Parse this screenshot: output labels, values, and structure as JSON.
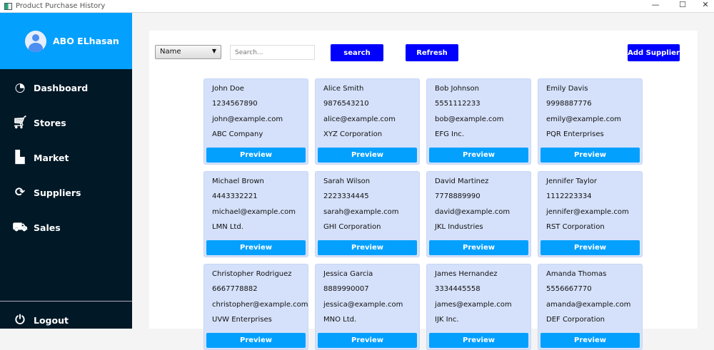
{
  "window": {
    "title": "Product Purchase History",
    "minimize": "—",
    "maximize": "☐",
    "close": "✕"
  },
  "sidebar": {
    "user": "ABO ELhasan",
    "items": [
      {
        "label": "Dashboard",
        "icon": "dashboard-icon"
      },
      {
        "label": "Stores",
        "icon": "cart-icon"
      },
      {
        "label": "Market",
        "icon": "store-icon"
      },
      {
        "label": "Suppliers",
        "icon": "suppliers-icon"
      },
      {
        "label": "Sales",
        "icon": "sales-icon"
      }
    ],
    "logout": "Logout"
  },
  "toolbar": {
    "filter": "Name",
    "search_placeholder": "Search...",
    "search_label": "search",
    "refresh_label": "Refresh",
    "add_label": "Add Supplier"
  },
  "suppliers": [
    {
      "name": "John Doe",
      "phone": "1234567890",
      "email": "john@example.com",
      "company": "ABC Company"
    },
    {
      "name": "Alice Smith",
      "phone": "9876543210",
      "email": "alice@example.com",
      "company": "XYZ Corporation"
    },
    {
      "name": "Bob Johnson",
      "phone": "5551112233",
      "email": "bob@example.com",
      "company": "EFG Inc."
    },
    {
      "name": "Emily Davis",
      "phone": "9998887776",
      "email": "emily@example.com",
      "company": "PQR Enterprises"
    },
    {
      "name": "Michael Brown",
      "phone": "4443332221",
      "email": "michael@example.com",
      "company": "LMN Ltd."
    },
    {
      "name": "Sarah Wilson",
      "phone": "2223334445",
      "email": "sarah@example.com",
      "company": "GHI Corporation"
    },
    {
      "name": "David Martinez",
      "phone": "7778889990",
      "email": "david@example.com",
      "company": "JKL Industries"
    },
    {
      "name": "Jennifer Taylor",
      "phone": "1112223334",
      "email": "jennifer@example.com",
      "company": "RST Corporation"
    },
    {
      "name": "Christopher Rodriguez",
      "phone": "6667778882",
      "email": "christopher@example.com",
      "company": "UVW Enterprises"
    },
    {
      "name": "Jessica Garcia",
      "phone": "8889990007",
      "email": "jessica@example.com",
      "company": "MNO Ltd."
    },
    {
      "name": "James Hernandez",
      "phone": "3334445558",
      "email": "james@example.com",
      "company": "IJK Inc."
    },
    {
      "name": "Amanda Thomas",
      "phone": "5556667770",
      "email": "amanda@example.com",
      "company": "DEF Corporation"
    }
  ],
  "preview_label": "Preview"
}
